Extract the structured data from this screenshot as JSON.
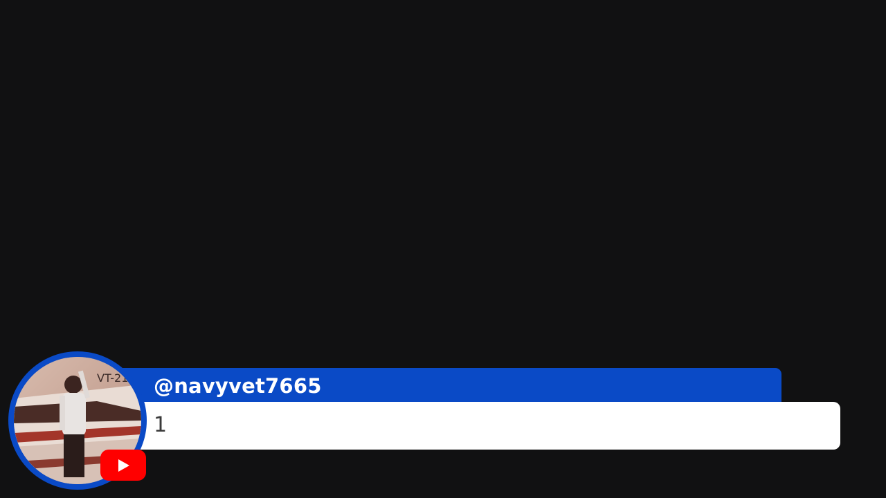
{
  "comment": {
    "username": "@navyvet7665",
    "message": "1"
  },
  "avatar": {
    "description_icon": "user-avatar-photo"
  },
  "badge": {
    "icon": "youtube-play-icon"
  },
  "colors": {
    "background": "#111112",
    "name_bar": "#0a4ac6",
    "message_bar": "#ffffff",
    "youtube_red": "#ff0000"
  }
}
